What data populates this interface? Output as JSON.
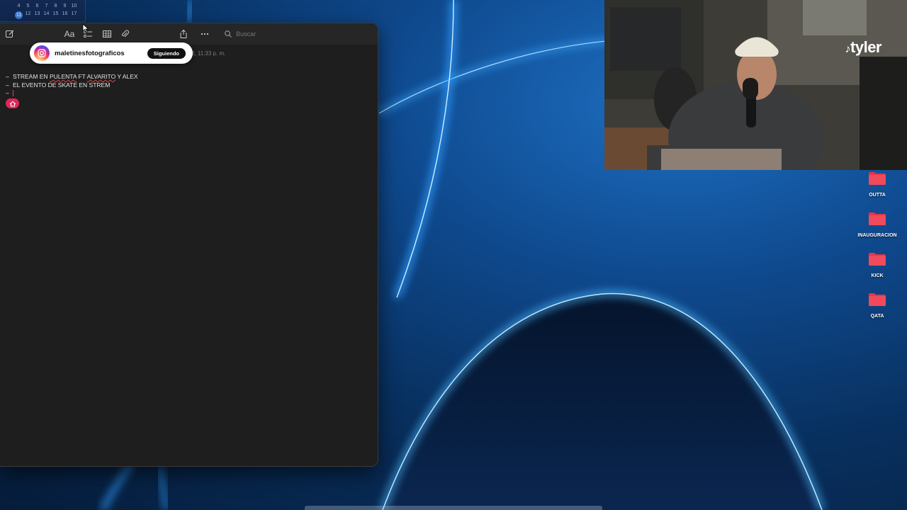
{
  "calendar": {
    "row1": [
      "4",
      "5",
      "6",
      "7",
      "8",
      "9",
      "10"
    ],
    "row2": [
      "11",
      "12",
      "13",
      "14",
      "15",
      "16",
      "17"
    ]
  },
  "notes": {
    "toolbar": {
      "compose_icon": "compose-icon",
      "format_label": "Aa",
      "checklist_icon": "checklist-icon",
      "table_icon": "table-icon",
      "attachment_icon": "paperclip-icon",
      "share_icon": "share-icon",
      "more_icon": "ellipsis-icon"
    },
    "search": {
      "placeholder": "Buscar"
    },
    "date_fragment": "3, 11:33 p. m.",
    "lines": [
      {
        "dash": "–",
        "parts": [
          "STREAM EN ",
          "PULENTA",
          " FT ",
          "ALVARITO",
          " Y ALEX"
        ]
      },
      {
        "dash": "–",
        "text": "EL EVENTO DE SKATE EN STREM"
      },
      {
        "dash": "–",
        "text": ""
      }
    ]
  },
  "instagram": {
    "username": "maletinesfotograficos",
    "follow_label": "Siguiendo"
  },
  "webcam": {
    "overlay_logo": "tyler"
  },
  "desktop": {
    "folders": [
      "OUTTA",
      "INAUGURACION",
      "KICK",
      "QATA"
    ],
    "folder_color": "#e8344a"
  },
  "colors": {
    "wallpaper_glow": "#2ea8ff",
    "notes_bg": "#1e1e1e",
    "accent_red": "#e0275a"
  }
}
